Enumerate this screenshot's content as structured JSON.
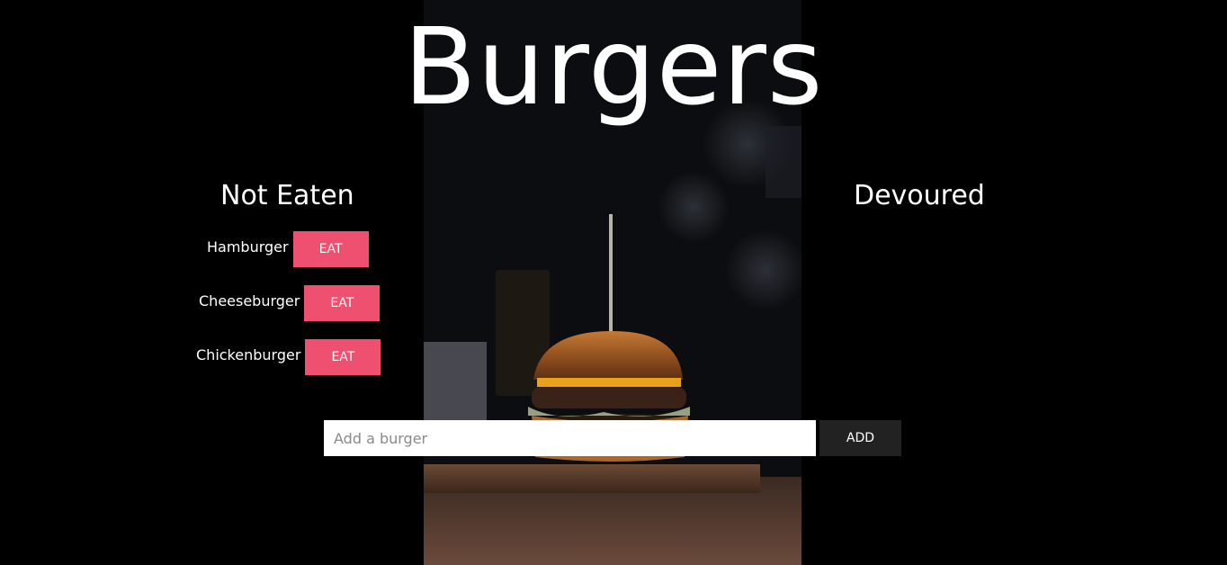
{
  "page": {
    "title": "Burgers"
  },
  "columns": {
    "not_eaten": {
      "heading": "Not Eaten",
      "items": [
        {
          "name": "Hamburger",
          "button": "EAT"
        },
        {
          "name": "Cheeseburger",
          "button": "EAT"
        },
        {
          "name": "Chickenburger",
          "button": "EAT"
        }
      ]
    },
    "devoured": {
      "heading": "Devoured",
      "items": []
    }
  },
  "add_form": {
    "placeholder": "Add a burger",
    "value": "",
    "button": "ADD"
  },
  "colors": {
    "background": "#000000",
    "eat_button": "#ef5070",
    "add_button": "#222222",
    "text": "#ffffff"
  },
  "icons": {
    "background": "burger-photo"
  }
}
